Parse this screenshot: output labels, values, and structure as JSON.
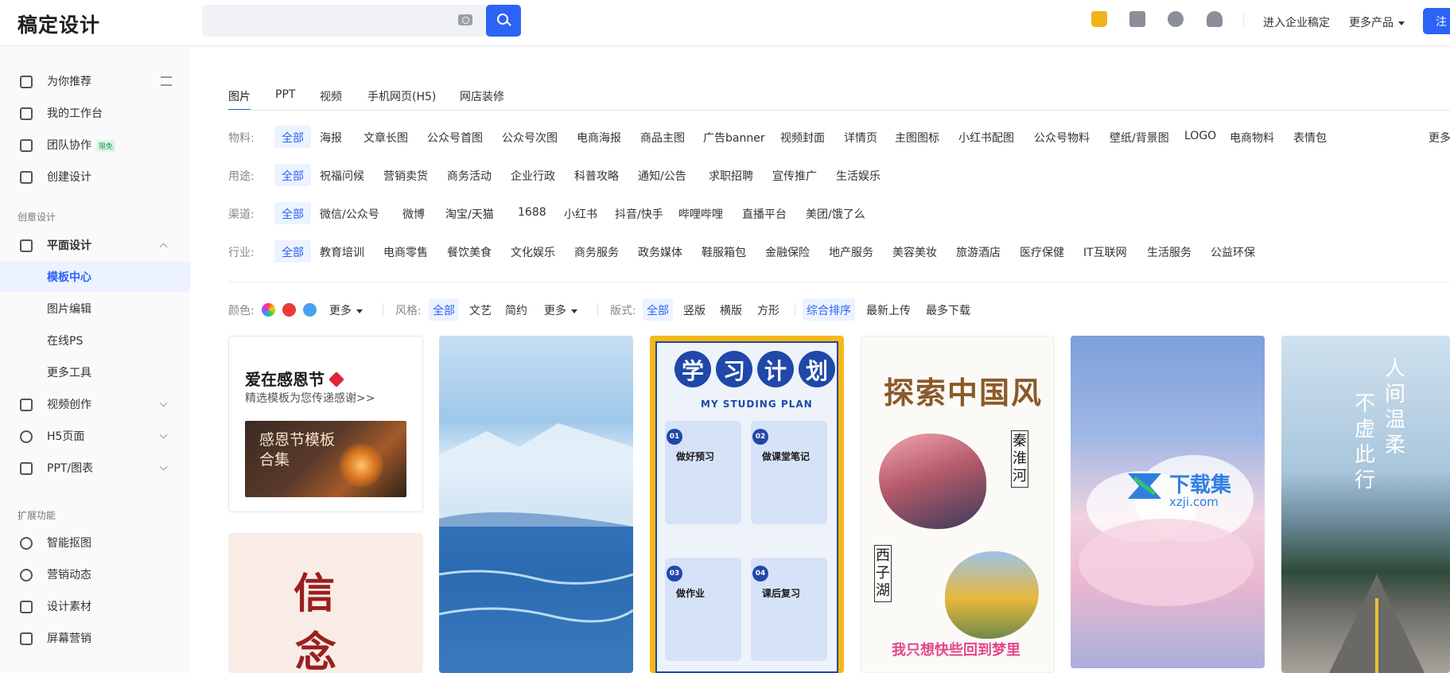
{
  "header": {
    "logo": "稿定设计",
    "search_placeholder": "",
    "links": [
      "进入企业稿定",
      "更多产品"
    ],
    "register": "注"
  },
  "sidebar": {
    "top_items": [
      {
        "label": "为你推荐"
      },
      {
        "label": "我的工作台"
      },
      {
        "label": "团队协作",
        "badge": "限免"
      },
      {
        "label": "创建设计"
      }
    ],
    "group1": "创意设计",
    "design_items": [
      {
        "label": "平面设计"
      },
      {
        "label": "模板中心"
      },
      {
        "label": "图片编辑"
      },
      {
        "label": "在线PS"
      },
      {
        "label": "更多工具"
      },
      {
        "label": "视频创作"
      },
      {
        "label": "H5页面"
      },
      {
        "label": "PPT/图表"
      }
    ],
    "group2": "扩展功能",
    "ext_items": [
      {
        "label": "智能抠图"
      },
      {
        "label": "营销动态"
      },
      {
        "label": "设计素材"
      },
      {
        "label": "屏幕营销"
      }
    ]
  },
  "tabs": [
    "图片",
    "PPT",
    "视频",
    "手机网页(H5)",
    "网店装修"
  ],
  "filters": {
    "material": {
      "label": "物料:",
      "items": [
        "全部",
        "海报",
        "文章长图",
        "公众号首图",
        "公众号次图",
        "电商海报",
        "商品主图",
        "广告banner",
        "视频封面",
        "详情页",
        "主图图标",
        "小红书配图",
        "公众号物料",
        "壁纸/背景图",
        "LOGO",
        "电商物料",
        "表情包"
      ],
      "more": "更多"
    },
    "usage": {
      "label": "用途:",
      "items": [
        "全部",
        "祝福问候",
        "营销卖货",
        "商务活动",
        "企业行政",
        "科普攻略",
        "通知/公告",
        "求职招聘",
        "宣传推广",
        "生活娱乐"
      ]
    },
    "channel": {
      "label": "渠道:",
      "items": [
        "全部",
        "微信/公众号",
        "微博",
        "淘宝/天猫",
        "1688",
        "小红书",
        "抖音/快手",
        "哔哩哔哩",
        "直播平台",
        "美团/饿了么"
      ]
    },
    "industry": {
      "label": "行业:",
      "items": [
        "全部",
        "教育培训",
        "电商零售",
        "餐饮美食",
        "文化娱乐",
        "商务服务",
        "政务媒体",
        "鞋服箱包",
        "金融保险",
        "地产服务",
        "美容美妆",
        "旅游酒店",
        "医疗保健",
        "IT互联网",
        "生活服务",
        "公益环保"
      ]
    }
  },
  "options": {
    "color_label": "颜色:",
    "colors": [
      "#ea3a3a",
      "#4aa1f0"
    ],
    "more1": "更多",
    "style_label": "风格:",
    "styles": [
      "全部",
      "文艺",
      "简约"
    ],
    "more2": "更多",
    "layout_label": "版式:",
    "layouts": [
      "全部",
      "竖版",
      "横版",
      "方形"
    ],
    "sorts": [
      "综合排序",
      "最新上传",
      "最多下载"
    ]
  },
  "cards": {
    "c1_title": "爱在感恩节",
    "c1_sub": "精选模板为您传递感谢>>",
    "c1_img": "感恩节模板合集",
    "c2_char1": "信",
    "c2_char2": "念",
    "c4_title": [
      "学",
      "习",
      "计",
      "划"
    ],
    "c4_sub": "MY STUDING PLAN",
    "c4_boxes": [
      "做好预习",
      "做课堂笔记",
      "做作业",
      "课后复习"
    ],
    "c4_nums": [
      "01",
      "02",
      "03",
      "04"
    ],
    "c5_title": "探索中国风",
    "c5_v1": "秦淮河",
    "c5_v2": "西子湖",
    "c5_caption": "我只想快些回到梦里",
    "c7_poem1": "人间温柔",
    "c7_poem2": "不虚此行"
  },
  "watermark": {
    "text": "下载集",
    "url": "xzji.com"
  }
}
